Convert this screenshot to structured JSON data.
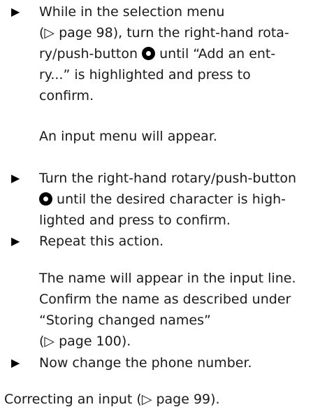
{
  "steps": [
    {
      "bullet": "▶",
      "lines": [
        "While in the selection menu",
        "(▷ page 98), turn the right-hand rota-",
        "ry/push-button",
        "until “Add an ent-",
        "ry...” is highlighted and press to",
        "confirm."
      ],
      "result": "An input menu will appear."
    },
    {
      "bullet": "▶",
      "lines": [
        "Turn the right-hand rotary/push-button",
        "until the desired character is high-",
        "lighted and press to confirm."
      ]
    },
    {
      "bullet": "▶",
      "lines": [
        "Repeat this action."
      ],
      "result_lines": [
        "The name will appear in the input line.",
        "Confirm the name as described under",
        "“Storing changed names”",
        "(▷ page 100)."
      ]
    },
    {
      "bullet": "▶",
      "lines": [
        "Now change the phone number."
      ]
    }
  ],
  "footer": "Correcting an input (▷ page 99).",
  "icons": {
    "knob": "rotary-push-button-icon"
  }
}
